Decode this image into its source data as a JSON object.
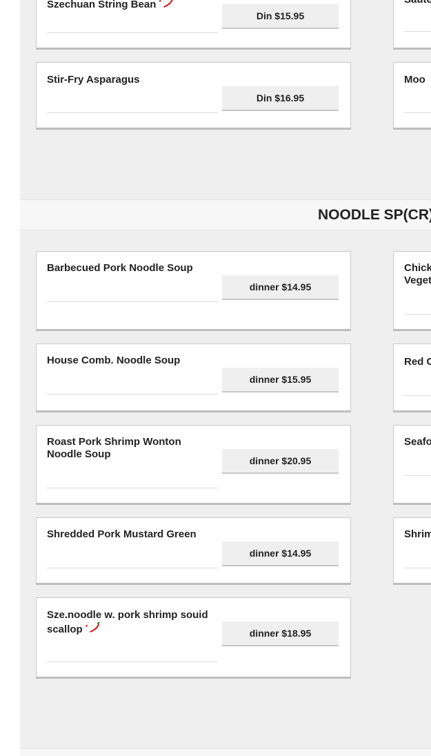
{
  "top_items": {
    "left": [
      {
        "name": "Szechuan String Bean",
        "spicy": true,
        "price": "Din $15.95"
      },
      {
        "name": "Stir-Fry Asparagus",
        "spicy": false,
        "price": "Din $16.95"
      }
    ],
    "right": [
      {
        "name": "Saute"
      },
      {
        "name": "Moo"
      }
    ]
  },
  "noodle_section": {
    "title": "NOODLE SP(CR)",
    "left": [
      {
        "name": "Barbecued Pork Noodle Soup",
        "spicy": false,
        "price": "dinner $14.95"
      },
      {
        "name": "House Comb. Noodle Soup",
        "spicy": false,
        "price": "dinner $15.95"
      },
      {
        "name": "Roast Pork Shrimp Wonton Noodle Soup",
        "spicy": false,
        "price": "dinner $20.95"
      },
      {
        "name": "Shredded Pork Mustard Green",
        "spicy": false,
        "price": "dinner $14.95"
      },
      {
        "name": "Sze.noodle w. pork shrimp souid scallop",
        "spicy": true,
        "price": "dinner $18.95"
      }
    ],
    "right": [
      {
        "name": "Chick\nVeget"
      },
      {
        "name": "Red C"
      },
      {
        "name": "Seafo"
      },
      {
        "name": "Shrim"
      }
    ]
  },
  "icons": {
    "spicy": "chili-pepper-icon"
  },
  "colors": {
    "panel": "#efefef",
    "card": "#ffffff",
    "price_button": "#efefef",
    "chili": "#d21f1f"
  }
}
